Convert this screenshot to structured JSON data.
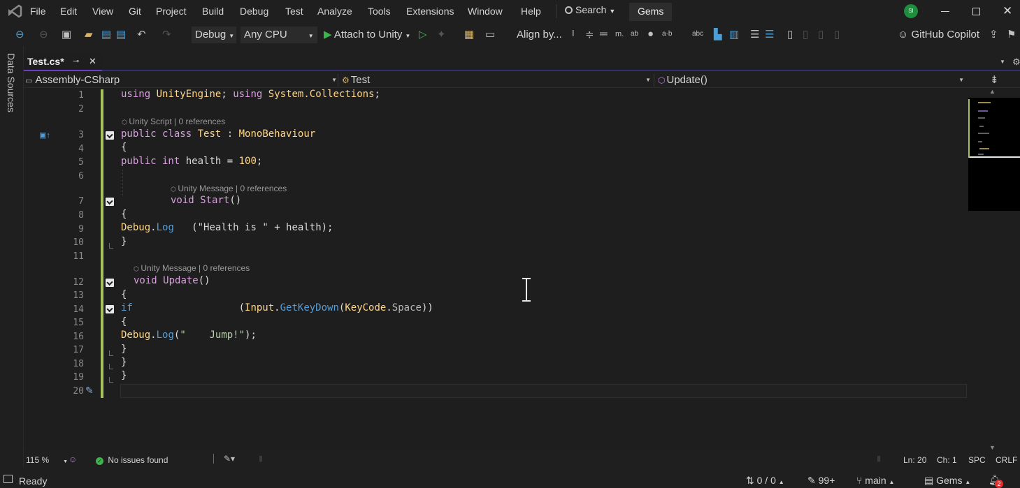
{
  "menubar": {
    "items": [
      "File",
      "Edit",
      "View",
      "Git",
      "Project",
      "Build",
      "Debug",
      "Test",
      "Analyze",
      "Tools",
      "Extensions",
      "Window",
      "Help"
    ],
    "search_label": "Search",
    "solution_name": "Gems",
    "account_initials": "SI"
  },
  "toolbar": {
    "configuration": "Debug",
    "platform": "Any CPU",
    "run_target": "Attach to Unity",
    "align_label": "Align by...",
    "copilot_label": "GitHub Copilot"
  },
  "leftrail": {
    "label": "Data Sources"
  },
  "tabs": [
    {
      "label": "Test.cs*"
    }
  ],
  "navbar": {
    "project": "Assembly-CSharp",
    "type": "Test",
    "member": "Update()"
  },
  "code": {
    "line_numbers": [
      "1",
      "2",
      "3",
      "4",
      "5",
      "6",
      "7",
      "8",
      "9",
      "10",
      "11",
      "12",
      "13",
      "14",
      "15",
      "16",
      "17",
      "18",
      "19",
      "20"
    ],
    "lens": {
      "class": "Unity Script | 0 references",
      "start": "Unity Message | 0 references",
      "update": "Unity Message | 0 references"
    },
    "lines": {
      "l1_a": "using",
      "l1_b": "UnityEngine",
      "l1_c": ";",
      "l1_d": "using",
      "l1_e": "System.Collections",
      "l1_f": ";",
      "l3_a": "public class",
      "l3_b": "Test",
      "l3_c": " : ",
      "l3_d": "MonoBehaviour",
      "l4": "{",
      "l5_a": "public int",
      "l5_b": " health = ",
      "l5_c": "100",
      "l5_d": ";",
      "l7_a": "void",
      "l7_b": "Start",
      "l7_c": "()",
      "l8": "{",
      "l9_a": "Debug",
      "l9_b": ".",
      "l9_c": "Log",
      "l9_d": "   (",
      "l9_e": "\"Health is \"",
      "l9_f": " + health);",
      "l10": "}",
      "l12_a": "void",
      "l12_b": "Update",
      "l12_c": "()",
      "l13": "{",
      "l14_a": "if",
      "l14_b": "                  (",
      "l14_c": "Input",
      "l14_d": ".",
      "l14_e": "GetKeyDown",
      "l14_f": "(",
      "l14_g": "KeyCode",
      "l14_h": ".",
      "l14_i": "Space",
      "l14_j": "))",
      "l15": "{",
      "l16_a": "Debug",
      "l16_b": ".",
      "l16_c": "Log",
      "l16_d": "(",
      "l16_e": "\"    Jump!\"",
      "l16_f": ");",
      "l17": "}",
      "l18": "}",
      "l19": "}"
    }
  },
  "editor_status": {
    "zoom": "115 %",
    "issues": "No issues found",
    "line": "Ln: 20",
    "col": "Ch: 1",
    "whitespace": "SPC",
    "line_ending": "CRLF"
  },
  "statusbar": {
    "state": "Ready",
    "sync": "0 / 0",
    "changes": "99+",
    "branch": "main",
    "repo": "Gems",
    "notifications": "2"
  },
  "colors": {
    "background": "#1f1f1f",
    "editor_bg": "#1e1e1e",
    "keyword": "#569cd6",
    "keyword_control": "#d8a0df",
    "type": "#4ec9b0",
    "string": "#d69d85",
    "number": "#b5cea8",
    "method": "#dcdcaa",
    "accent": "#6b3fc4",
    "modified_bar": "#a5c25c"
  }
}
